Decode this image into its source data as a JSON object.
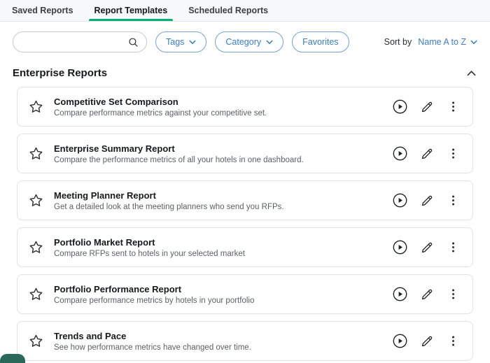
{
  "tabs": [
    {
      "label": "Saved Reports",
      "active": false
    },
    {
      "label": "Report Templates",
      "active": true
    },
    {
      "label": "Scheduled Reports",
      "active": false
    }
  ],
  "filters": {
    "search_placeholder": "",
    "search_value": "",
    "tags_label": "Tags",
    "category_label": "Category",
    "favorites_label": "Favorites",
    "sort_by_label": "Sort by",
    "sort_value": "Name A to Z"
  },
  "section": {
    "title": "Enterprise Reports"
  },
  "reports": [
    {
      "title": "Competitive Set Comparison",
      "description": "Compare performance metrics against your competitive set."
    },
    {
      "title": "Enterprise Summary Report",
      "description": "Compare the performance metrics of all your hotels in one dashboard."
    },
    {
      "title": "Meeting Planner Report",
      "description": "Get a detailed look at the meeting planners who send you RFPs."
    },
    {
      "title": "Portfolio Market Report",
      "description": "Compare RFPs sent to hotels in your selected market"
    },
    {
      "title": "Portfolio Performance Report",
      "description": "Compare performance metrics by hotels in your portfolio"
    },
    {
      "title": "Trends and Pace",
      "description": "See how performance metrics have changed over time."
    }
  ],
  "icons": {
    "search": "magnifier",
    "chevron_down": "chevron-down",
    "chevron_up": "chevron-up",
    "favorite": "star-outline",
    "run": "play-circle",
    "edit": "pencil",
    "more": "vertical-ellipsis"
  },
  "colors": {
    "accent_green": "#00b274",
    "accent_blue": "#3c7dc4",
    "chat_widget": "#2a685a"
  }
}
